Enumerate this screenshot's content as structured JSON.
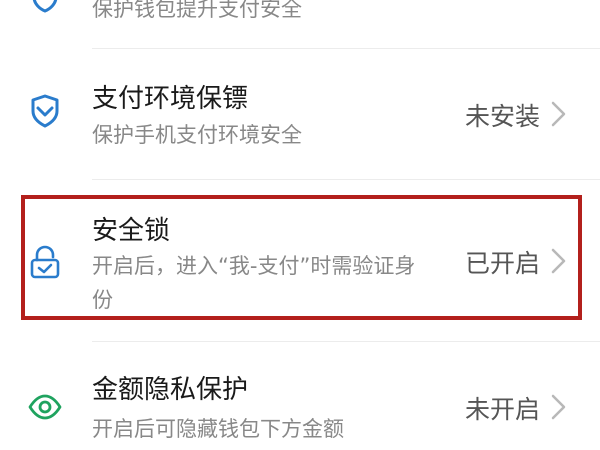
{
  "colors": {
    "accent_blue": "#2a7ccc",
    "accent_green": "#1fa35f",
    "highlight_red": "#b3201c"
  },
  "rows": [
    {
      "title": "",
      "subtitle": "保护钱包提升支付安全",
      "status": "",
      "icon": "shield-icon"
    },
    {
      "title": "支付环境保镖",
      "subtitle": "保护手机支付环境安全",
      "status": "未安装",
      "icon": "shield-check-icon"
    },
    {
      "title": "安全锁",
      "subtitle": "开启后，进入“我-支付”时需验证身份",
      "status": "已开启",
      "icon": "lock-icon"
    },
    {
      "title": "金额隐私保护",
      "subtitle": "开启后可隐藏钱包下方金额",
      "status": "未开启",
      "icon": "eye-icon"
    }
  ]
}
